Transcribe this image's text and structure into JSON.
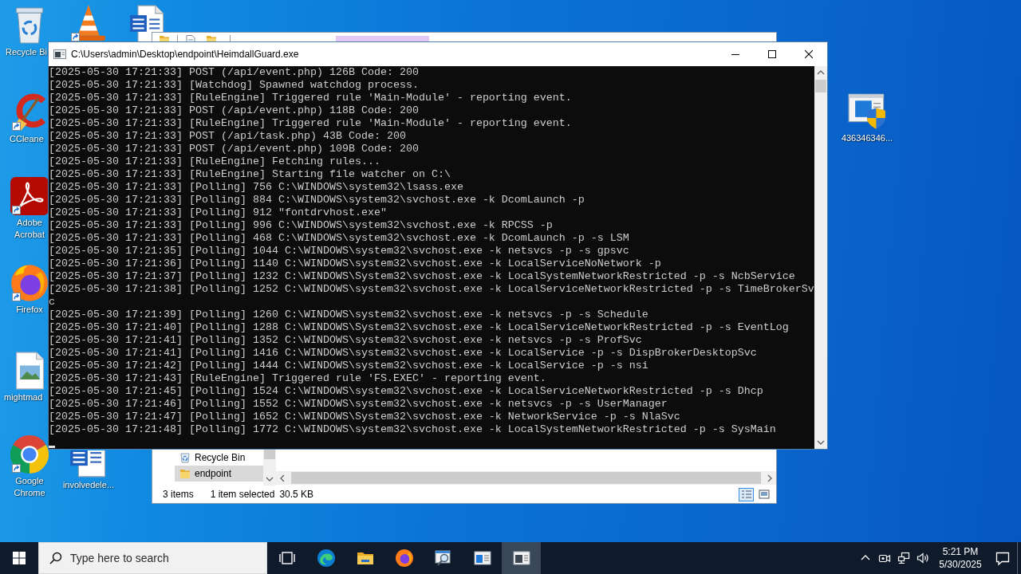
{
  "desktop": {
    "icons": [
      {
        "kind": "recycle",
        "label": "Recycle Bi",
        "shortcut": false
      },
      {
        "kind": "cone",
        "shortcut": true
      },
      {
        "kind": "word",
        "shortcut": false
      },
      {
        "kind": "cleaner",
        "label": "CCleane",
        "shortcut": true
      },
      {
        "kind": "pdf",
        "label": "Adobe Acrobat",
        "shortcut": true
      },
      {
        "kind": "firefox",
        "label": "Firefox",
        "shortcut": true
      },
      {
        "kind": "image",
        "label": "mightmad",
        "shortcut": false
      },
      {
        "kind": "chrome",
        "label": "Google Chrome",
        "shortcut": true
      },
      {
        "kind": "word",
        "label": "involvedele...",
        "shortcut": false
      },
      {
        "kind": "setup",
        "label": "436346346...",
        "shortcut": false
      }
    ]
  },
  "explorer": {
    "nav_items": [
      {
        "kind": "recycle",
        "label": "Recycle Bin",
        "selected": false
      },
      {
        "kind": "folder",
        "label": "endpoint",
        "selected": true
      }
    ],
    "status": {
      "item_count": "3 items",
      "selection": "1 item selected",
      "size": "30.5 KB"
    },
    "views": [
      {
        "kind": "details",
        "selected": true
      },
      {
        "kind": "tiles",
        "selected": false
      }
    ]
  },
  "console": {
    "title": "C:\\Users\\admin\\Desktop\\endpoint\\HeimdallGuard.exe",
    "lines": [
      "[2025-05-30 17:21:33] POST (/api/event.php) 126B Code: 200",
      "[2025-05-30 17:21:33] [Watchdog] Spawned watchdog process.",
      "[2025-05-30 17:21:33] [RuleEngine] Triggered rule 'Main-Module' - reporting event.",
      "[2025-05-30 17:21:33] POST (/api/event.php) 118B Code: 200",
      "[2025-05-30 17:21:33] [RuleEngine] Triggered rule 'Main-Module' - reporting event.",
      "[2025-05-30 17:21:33] POST (/api/task.php) 43B Code: 200",
      "[2025-05-30 17:21:33] POST (/api/event.php) 109B Code: 200",
      "[2025-05-30 17:21:33] [RuleEngine] Fetching rules...",
      "[2025-05-30 17:21:33] [RuleEngine] Starting file watcher on C:\\",
      "[2025-05-30 17:21:33] [Polling] 756 C:\\WINDOWS\\system32\\lsass.exe",
      "[2025-05-30 17:21:33] [Polling] 884 C:\\WINDOWS\\system32\\svchost.exe -k DcomLaunch -p",
      "[2025-05-30 17:21:33] [Polling] 912 \"fontdrvhost.exe\"",
      "[2025-05-30 17:21:33] [Polling] 996 C:\\WINDOWS\\system32\\svchost.exe -k RPCSS -p",
      "[2025-05-30 17:21:33] [Polling] 468 C:\\WINDOWS\\system32\\svchost.exe -k DcomLaunch -p -s LSM",
      "[2025-05-30 17:21:35] [Polling] 1044 C:\\WINDOWS\\system32\\svchost.exe -k netsvcs -p -s gpsvc",
      "[2025-05-30 17:21:36] [Polling] 1140 C:\\WINDOWS\\system32\\svchost.exe -k LocalServiceNoNetwork -p",
      "[2025-05-30 17:21:37] [Polling] 1232 C:\\WINDOWS\\System32\\svchost.exe -k LocalSystemNetworkRestricted -p -s NcbService",
      "[2025-05-30 17:21:38] [Polling] 1252 C:\\WINDOWS\\system32\\svchost.exe -k LocalServiceNetworkRestricted -p -s TimeBrokerSv",
      "c",
      "[2025-05-30 17:21:39] [Polling] 1260 C:\\WINDOWS\\system32\\svchost.exe -k netsvcs -p -s Schedule",
      "[2025-05-30 17:21:40] [Polling] 1288 C:\\WINDOWS\\System32\\svchost.exe -k LocalServiceNetworkRestricted -p -s EventLog",
      "[2025-05-30 17:21:41] [Polling] 1352 C:\\WINDOWS\\system32\\svchost.exe -k netsvcs -p -s ProfSvc",
      "[2025-05-30 17:21:41] [Polling] 1416 C:\\WINDOWS\\system32\\svchost.exe -k LocalService -p -s DispBrokerDesktopSvc",
      "[2025-05-30 17:21:42] [Polling] 1444 C:\\WINDOWS\\system32\\svchost.exe -k LocalService -p -s nsi",
      "[2025-05-30 17:21:43] [RuleEngine] Triggered rule 'FS.EXEC' - reporting event.",
      "[2025-05-30 17:21:45] [Polling] 1524 C:\\WINDOWS\\system32\\svchost.exe -k LocalServiceNetworkRestricted -p -s Dhcp",
      "[2025-05-30 17:21:46] [Polling] 1552 C:\\WINDOWS\\system32\\svchost.exe -k netsvcs -p -s UserManager",
      "[2025-05-30 17:21:47] [Polling] 1652 C:\\WINDOWS\\System32\\svchost.exe -k NetworkService -p -s NlaSvc",
      "[2025-05-30 17:21:48] [Polling] 1772 C:\\WINDOWS\\system32\\svchost.exe -k LocalSystemNetworkRestricted -p -s SysMain"
    ]
  },
  "taskbar": {
    "search": {
      "placeholder": "Type here to search"
    },
    "apps": [
      {
        "kind": "taskview",
        "selected": false
      },
      {
        "kind": "edge",
        "selected": false
      },
      {
        "kind": "folder",
        "selected": false
      },
      {
        "kind": "firefox",
        "selected": false
      },
      {
        "kind": "magnifier",
        "selected": false
      },
      {
        "kind": "window",
        "selected": false
      },
      {
        "kind": "console",
        "selected": true
      }
    ],
    "clock": {
      "time": "5:21 PM",
      "date": "5/30/2025"
    }
  }
}
